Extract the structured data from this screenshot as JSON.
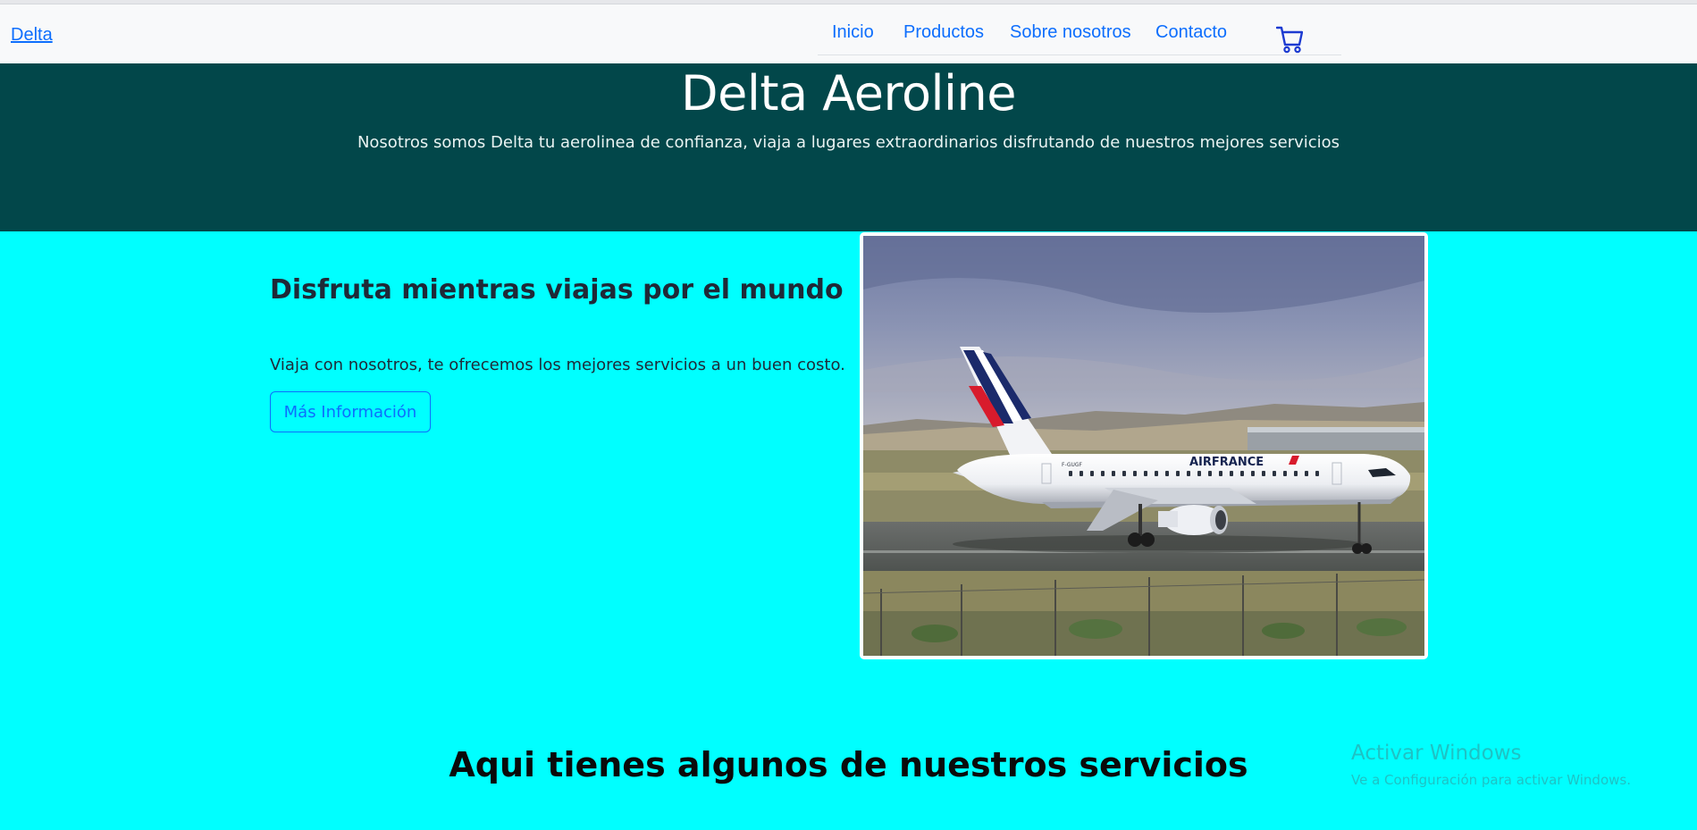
{
  "navbar": {
    "brand": "Delta",
    "links": [
      "Inicio",
      "Productos",
      "Sobre nosotros",
      "Contacto"
    ],
    "cart_icon": "shopping-cart-icon"
  },
  "hero": {
    "title": "Delta Aeroline",
    "subtitle": "Nosotros somos Delta tu aerolinea de confianza, viaja a lugares extraordinarios disfrutando de nuestros mejores servicios",
    "background_color": "#02474a"
  },
  "feature": {
    "heading": "Disfruta mientras viajas por el mundo",
    "text": "Viaja con nosotros, te ofrecemos los mejores servicios a un buen costo.",
    "button_label": "Más Información",
    "image": {
      "airline_text": "AIRFRANCE",
      "registration": "F-GUGF"
    }
  },
  "services": {
    "heading": "Aqui tienes algunos de nuestros servicios"
  },
  "watermark": {
    "title": "Activar Windows",
    "subtitle": "Ve a Configuración para activar Windows."
  },
  "colors": {
    "page_background": "#00ffff",
    "link": "#0d6efd",
    "navbar_background": "#f8f9fa"
  }
}
